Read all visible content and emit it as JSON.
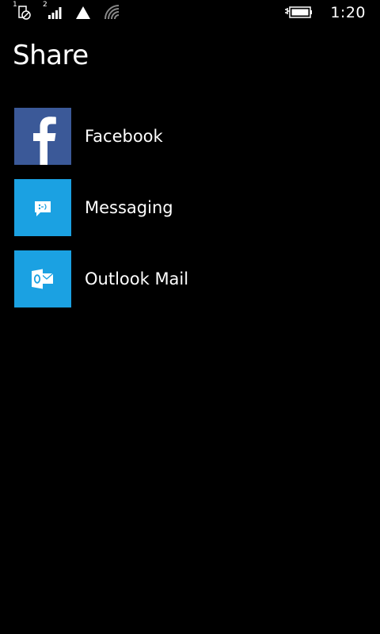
{
  "status_bar": {
    "sim1_label": "1",
    "sim2_label": "2",
    "icons": [
      "no-sim-icon",
      "signal-bars-icon",
      "data-triangle-icon",
      "wifi-icon",
      "battery-charging-icon"
    ],
    "time": "1:20"
  },
  "page": {
    "title": "Share"
  },
  "share_targets": [
    {
      "label": "Facebook",
      "icon": "facebook-icon",
      "tile_color": "#3b5998"
    },
    {
      "label": "Messaging",
      "icon": "messaging-icon",
      "tile_color": "#1ba1e2"
    },
    {
      "label": "Outlook Mail",
      "icon": "outlook-mail-icon",
      "tile_color": "#1ba1e2"
    }
  ],
  "colors": {
    "background": "#000000",
    "text": "#ffffff",
    "facebook_blue": "#3b5998",
    "accent_blue": "#1ba1e2"
  }
}
